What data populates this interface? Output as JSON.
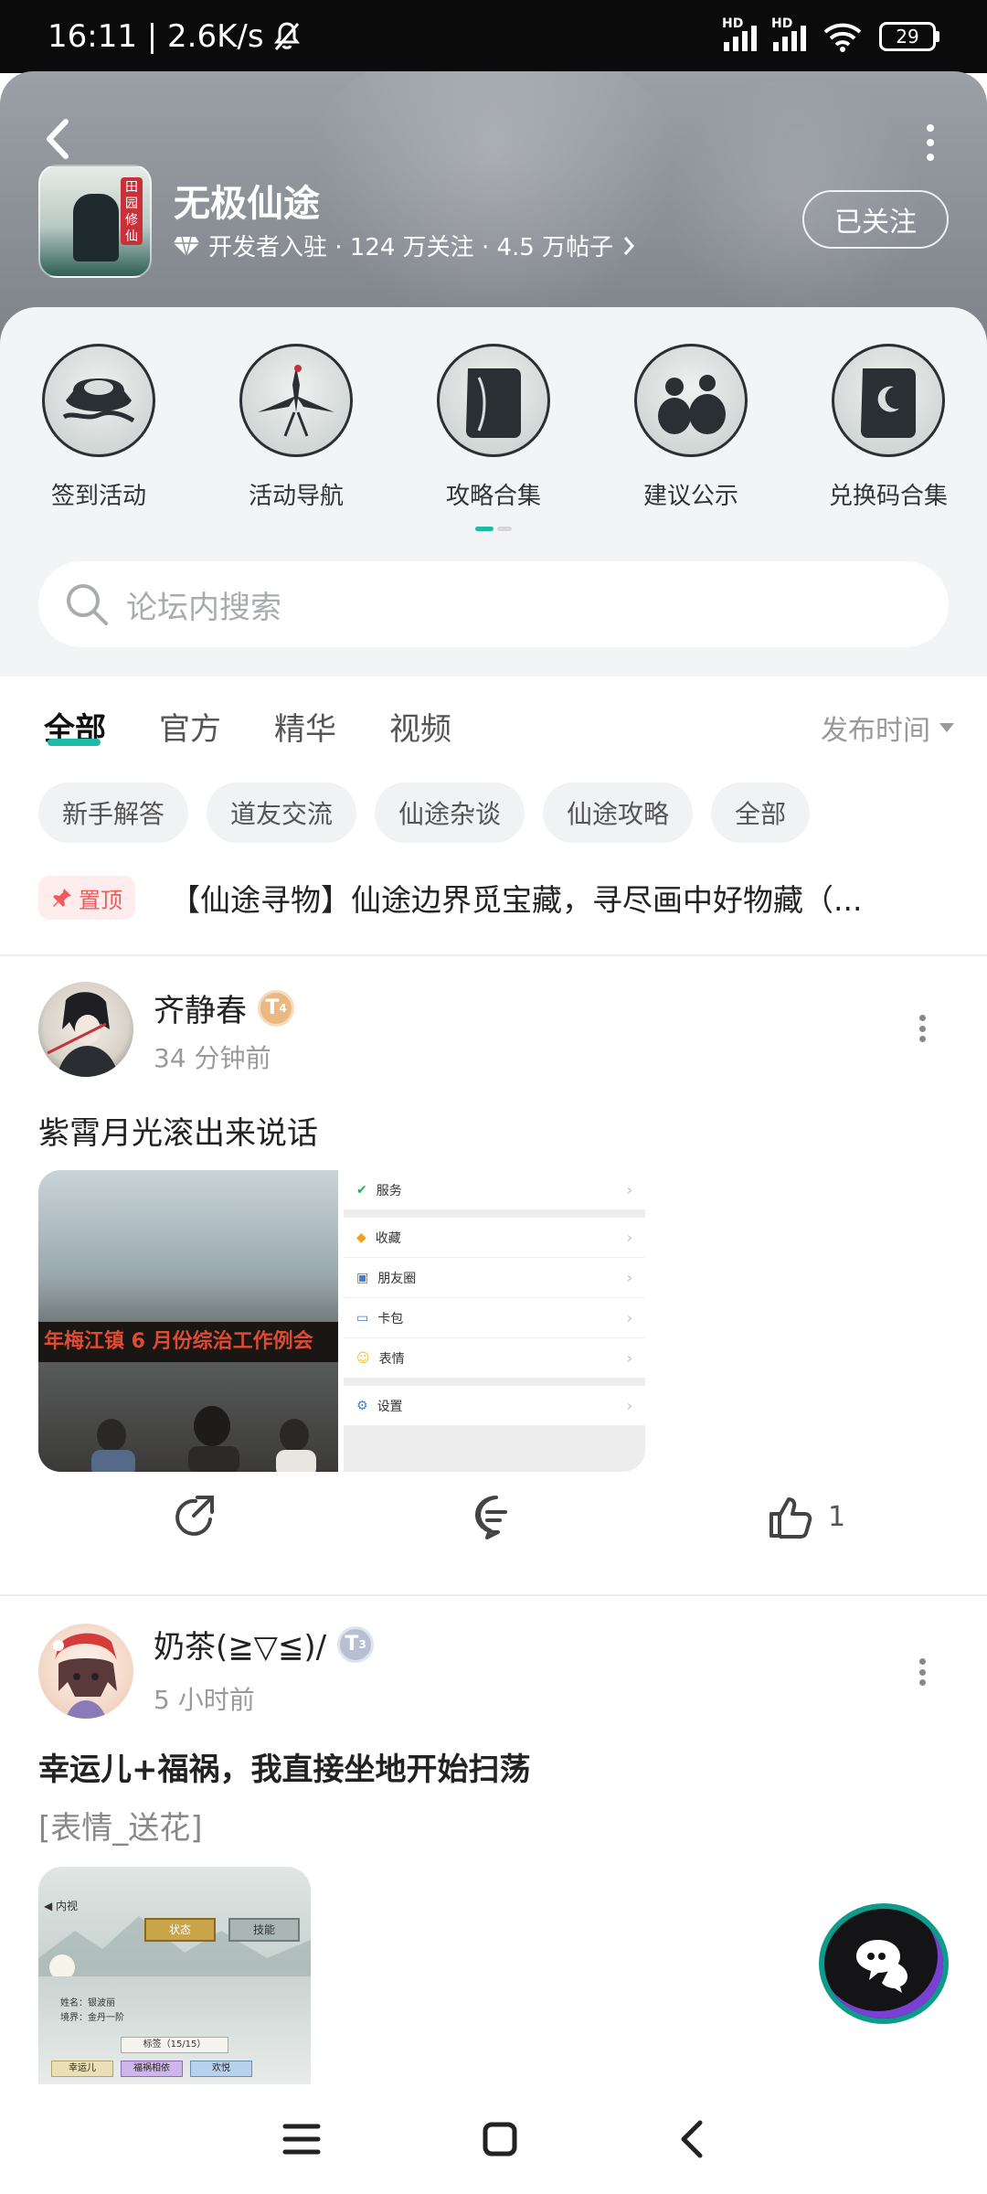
{
  "status_bar": {
    "time_speed": "16:11 | 2.6K/s",
    "battery": "29",
    "network_labels": [
      "HD",
      "HD"
    ]
  },
  "header": {
    "forum_name": "无极仙途",
    "meta": "开发者入驻 · 124 万关注 · 4.5 万帖子",
    "follow_label": "已关注",
    "icon_badge": "田园修仙"
  },
  "shortcuts": [
    {
      "label": "签到活动",
      "icon": "gold-ingot-icon"
    },
    {
      "label": "活动导航",
      "icon": "crane-icon"
    },
    {
      "label": "攻略合集",
      "icon": "scroll-book-icon"
    },
    {
      "label": "建议公示",
      "icon": "gourd-icon"
    },
    {
      "label": "兑换码合集",
      "icon": "moon-scroll-icon"
    }
  ],
  "search": {
    "placeholder": "论坛内搜索"
  },
  "tabs": {
    "items": [
      "全部",
      "官方",
      "精华",
      "视频"
    ],
    "active": "全部",
    "sort_label": "发布时间"
  },
  "chips": [
    "新手解答",
    "道友交流",
    "仙途杂谈",
    "仙途攻略",
    "全部"
  ],
  "pinned": {
    "badge": "置顶",
    "title": "【仙途寻物】仙途边界觅宝藏，寻尽画中好物藏（..."
  },
  "posts": [
    {
      "author": "齐静春",
      "level": "T",
      "level_sub": "4",
      "time": "34 分钟前",
      "title": "紫霄月光滚出来说话",
      "photo_banner": "年梅江镇 6 月份综治工作例会",
      "menu_items": [
        "服务",
        "收藏",
        "朋友圈",
        "卡包",
        "表情",
        "设置"
      ],
      "likes": "1"
    },
    {
      "author": "奶茶(≧▽≦)/",
      "level": "T",
      "level_sub": "3",
      "time": "5 小时前",
      "title": "幸运儿+福祸，我直接坐地开始扫荡",
      "subtitle": "[表情_送花]",
      "game_ui": {
        "back": "内视",
        "btn1": "状态",
        "btn2": "技能",
        "name_line": "姓名：银波丽",
        "realm_line": "境界：金丹一阶",
        "tags": "标签（15/15）",
        "tag1": "幸运儿",
        "tag2": "福祸相依",
        "tag3": "欢悦"
      }
    }
  ],
  "colors": {
    "accent": "#1dbaa4",
    "pin": "#f05a5a",
    "header_bg": "#8e9399"
  }
}
